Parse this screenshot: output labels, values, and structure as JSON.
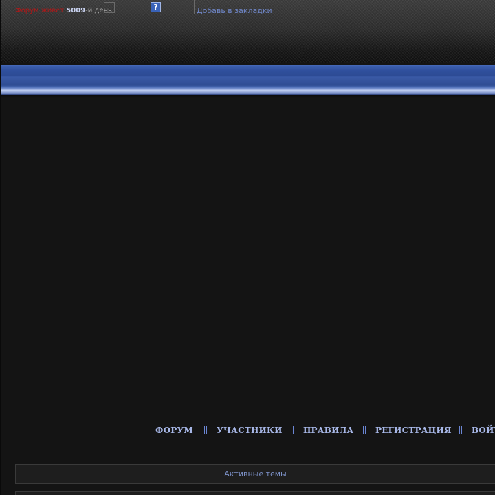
{
  "header": {
    "status": {
      "alive_text": "Форум живет",
      "days": "5009",
      "days_suffix": "-й день."
    },
    "help_label": "?",
    "bookmark_link": "Добавь в закладки"
  },
  "nav": {
    "items": [
      {
        "label": "ФОРУМ"
      },
      {
        "label": "УЧАСТНИКИ"
      },
      {
        "label": "ПРАВИЛА"
      },
      {
        "label": "РЕГИСТРАЦИЯ"
      },
      {
        "label": "ВОЙТИ"
      }
    ]
  },
  "active_topics": {
    "label": "Активные темы"
  },
  "colors": {
    "background": "#141414",
    "accent_blue": "#2f4f9c",
    "link_blue": "#6f86c7",
    "nav_text": "#a8b8e8",
    "alive_red": "#b01818"
  }
}
